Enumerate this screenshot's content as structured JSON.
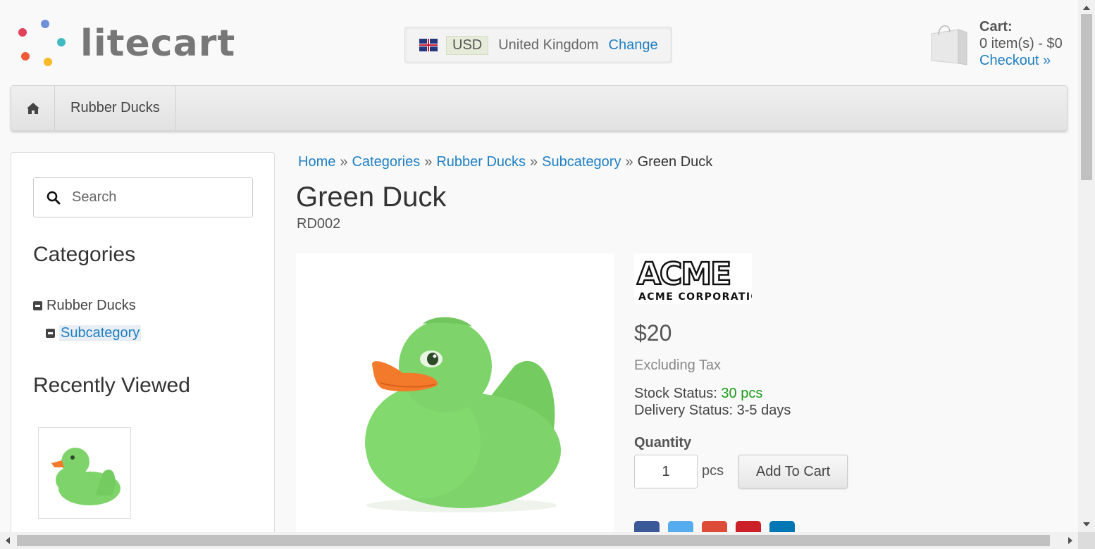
{
  "header": {
    "logo_text": "litecart",
    "region": {
      "currency": "USD",
      "country": "United Kingdom",
      "change_label": "Change"
    },
    "cart": {
      "title": "Cart:",
      "summary": "0 item(s) - $0",
      "checkout_label": "Checkout »"
    }
  },
  "nav": {
    "home_icon": "home-icon",
    "items": [
      {
        "label": "Rubber Ducks"
      }
    ]
  },
  "sidebar": {
    "search_placeholder": "Search",
    "categories_heading": "Categories",
    "categories": [
      {
        "label": "Rubber Ducks"
      },
      {
        "label": "Subcategory"
      }
    ],
    "recently_viewed_heading": "Recently Viewed"
  },
  "breadcrumb": [
    {
      "label": "Home"
    },
    {
      "label": "Categories"
    },
    {
      "label": "Rubber Ducks"
    },
    {
      "label": "Subcategory"
    },
    {
      "label": "Green Duck"
    }
  ],
  "breadcrumb_separator": "»",
  "product": {
    "title": "Green Duck",
    "sku": "RD002",
    "brand": "ACME CORPORATION",
    "price": "$20",
    "tax_note": "Excluding Tax",
    "stock_label": "Stock Status:",
    "stock_value": "30 pcs",
    "delivery_label": "Delivery Status:",
    "delivery_value": "3-5 days",
    "quantity_label": "Quantity",
    "quantity_value": "1",
    "unit": "pcs",
    "add_to_cart_label": "Add To Cart"
  },
  "colors": {
    "link": "#1e7fc3",
    "in_stock": "#1a9a1a",
    "duck_green": "#7ed46a",
    "beak_orange": "#f47a2b"
  }
}
